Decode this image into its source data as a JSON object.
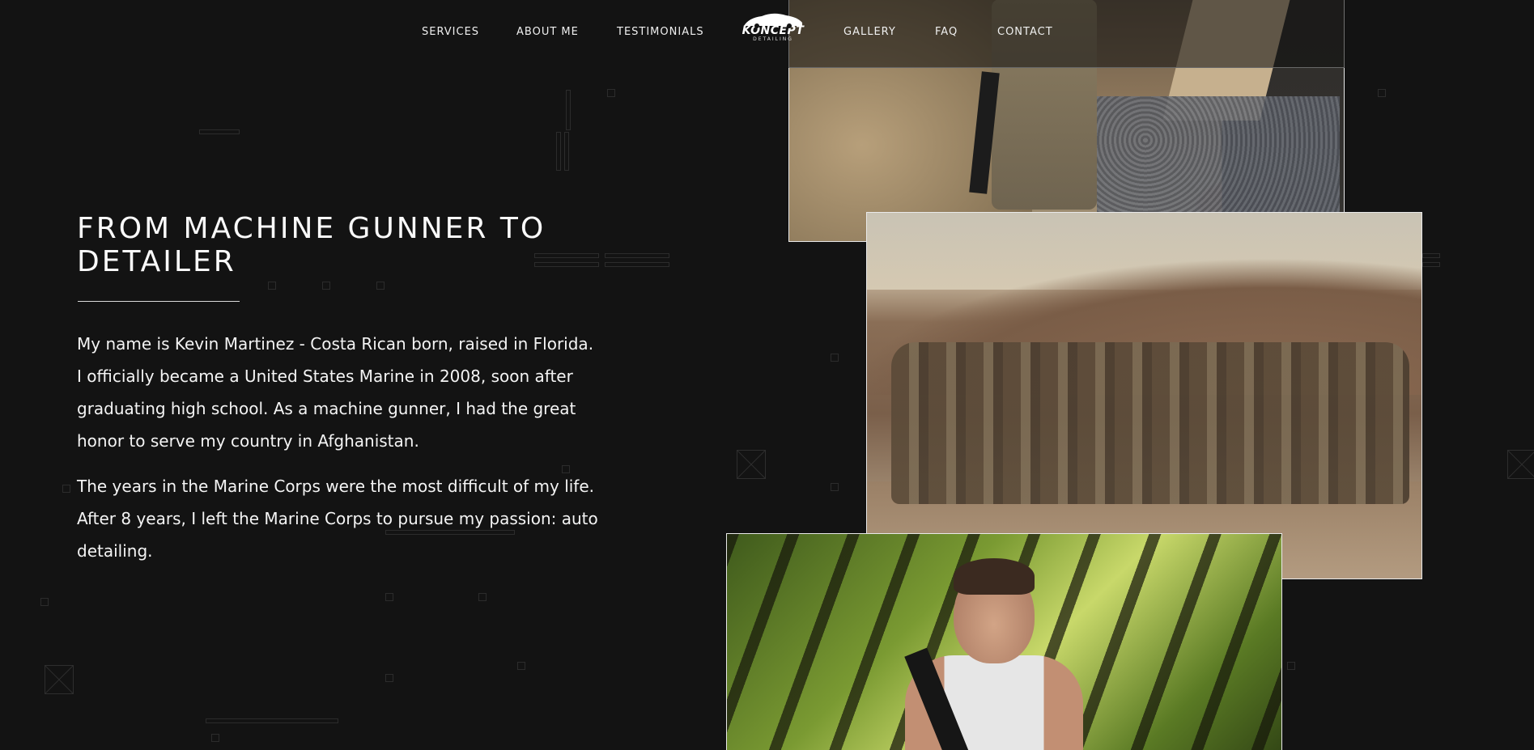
{
  "nav": {
    "links": [
      "SERVICES",
      "ABOUT ME",
      "TESTIMONIALS",
      "GALLERY",
      "FAQ",
      "CONTACT"
    ],
    "logo_word": "KONCEPT",
    "logo_sub": "DETAILING"
  },
  "about": {
    "title": "FROM MACHINE GUNNER TO DETAILER",
    "paragraphs": [
      "My name is Kevin Martinez - Costa Rican born, raised in Florida. I officially became a United States Marine in 2008, soon after graduating high school. As a machine gunner, I had the great honor to serve my country in Afghanistan.",
      "The years in the Marine Corps were the most difficult of my life. After 8 years, I left the Marine Corps to pursue my passion: auto detailing."
    ]
  },
  "photos": {
    "names": [
      "marine-standing-photo",
      "platoon-group-photo",
      "kevin-jungle-photo"
    ]
  },
  "colors": {
    "background": "#131313",
    "text": "#f2f2f2",
    "rule": "#d9d9d9"
  }
}
